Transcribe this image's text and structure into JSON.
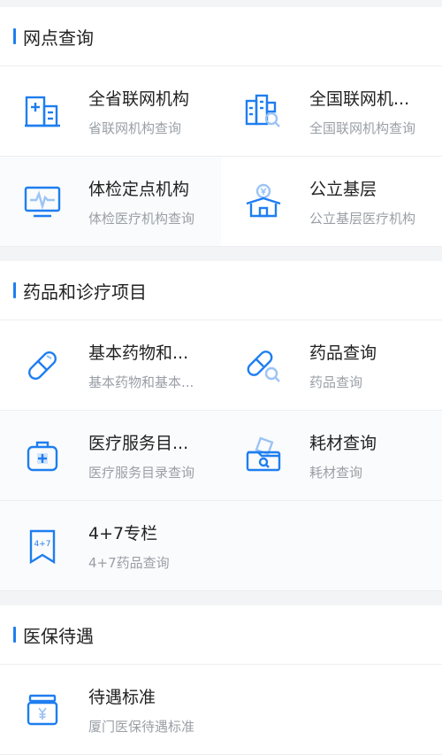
{
  "sections": [
    {
      "title": "网点查询",
      "items": [
        {
          "title": "全省联网机构",
          "sub": "省联网机构查询",
          "icon": "hospital-building-icon"
        },
        {
          "title": "全国联网机...",
          "sub": "全国联网机构查询",
          "icon": "building-search-icon"
        },
        {
          "title": "体检定点机构",
          "sub": "体检医疗机构查询",
          "icon": "heart-monitor-icon"
        },
        {
          "title": "公立基层",
          "sub": "公立基层医疗机构",
          "icon": "yuan-building-icon"
        }
      ]
    },
    {
      "title": "药品和诊疗项目",
      "items": [
        {
          "title": "基本药物和...",
          "sub": "基本药物和基本...",
          "icon": "pill-icon"
        },
        {
          "title": "药品查询",
          "sub": "药品查询",
          "icon": "pill-search-icon"
        },
        {
          "title": "医疗服务目...",
          "sub": "医疗服务目录查询",
          "icon": "medical-kit-icon"
        },
        {
          "title": "耗材查询",
          "sub": "耗材查询",
          "icon": "supplies-box-icon"
        },
        {
          "title": "4+7专栏",
          "sub": "4+7药品查询",
          "icon": "bookmark-4plus7-icon",
          "badge": "4+7"
        }
      ]
    },
    {
      "title": "医保待遇",
      "items": [
        {
          "title": "待遇标准",
          "sub": "厦门医保待遇标准",
          "icon": "yuan-box-icon"
        }
      ]
    }
  ],
  "colors": {
    "accent": "#1e7ef0",
    "muted": "#9a9fa6"
  }
}
